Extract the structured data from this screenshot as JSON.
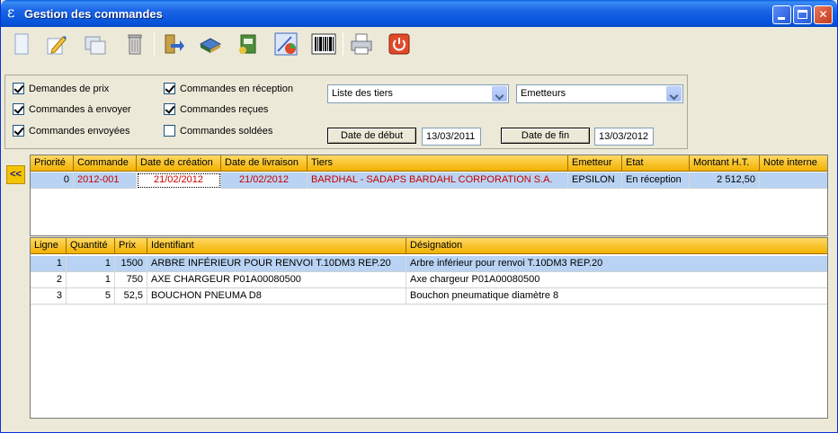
{
  "window": {
    "title": "Gestion des commandes",
    "app_icon": "epsilon-icon"
  },
  "toolbar": {
    "buttons": [
      {
        "icon": "new-document-icon"
      },
      {
        "icon": "edit-icon"
      },
      {
        "icon": "duplicate-icon"
      },
      {
        "icon": "delete-bin-icon"
      },
      {
        "icon": "transfer-icon"
      },
      {
        "icon": "books-icon"
      },
      {
        "icon": "catalog-icon"
      },
      {
        "icon": "chart-icon"
      },
      {
        "icon": "barcode-icon"
      },
      {
        "icon": "printer-icon"
      },
      {
        "icon": "power-icon"
      }
    ]
  },
  "filters": {
    "checks": [
      {
        "label": "Demandes de prix",
        "checked": true
      },
      {
        "label": "Commandes à envoyer",
        "checked": true
      },
      {
        "label": "Commandes envoyées",
        "checked": true
      },
      {
        "label": "Commandes en réception",
        "checked": true
      },
      {
        "label": "Commandes reçues",
        "checked": true
      },
      {
        "label": "Commandes soldées",
        "checked": false
      }
    ],
    "tiers_combo": "Liste des tiers",
    "emetteurs_combo": "Emetteurs",
    "start_button": "Date de début",
    "start_date": "13/03/2011",
    "end_button": "Date de fin",
    "end_date": "13/03/2012"
  },
  "side_button": "<<",
  "orders": {
    "headers": [
      "Priorité",
      "Commande",
      "Date de création",
      "Date de livraison",
      "Tiers",
      "Emetteur",
      "Etat",
      "Montant H.T.",
      "Note interne"
    ],
    "rows": [
      {
        "priorite": "0",
        "commande": "2012-001",
        "creation": "21/02/2012",
        "livraison": "21/02/2012",
        "tiers": "BARDHAL - SADAPS BARDAHL  CORPORATION S.A.",
        "emetteur": "EPSILON",
        "etat": "En réception",
        "montant": "2 512,50",
        "note": ""
      }
    ]
  },
  "lines": {
    "headers": [
      "Ligne",
      "Quantité",
      "Prix",
      "Identifiant",
      "Désignation"
    ],
    "rows": [
      {
        "ligne": "1",
        "quantite": "1",
        "prix": "1500",
        "identifiant": "ARBRE INFÉRIEUR POUR RENVOI T.10DM3 REP.20",
        "designation": "Arbre inférieur pour renvoi T.10DM3 REP.20"
      },
      {
        "ligne": "2",
        "quantite": "1",
        "prix": "750",
        "identifiant": "AXE CHARGEUR P01A00080500",
        "designation": "Axe chargeur P01A00080500"
      },
      {
        "ligne": "3",
        "quantite": "5",
        "prix": "52,5",
        "identifiant": "BOUCHON PNEUMA D8",
        "designation": "Bouchon pneumatique diamètre 8"
      }
    ]
  }
}
